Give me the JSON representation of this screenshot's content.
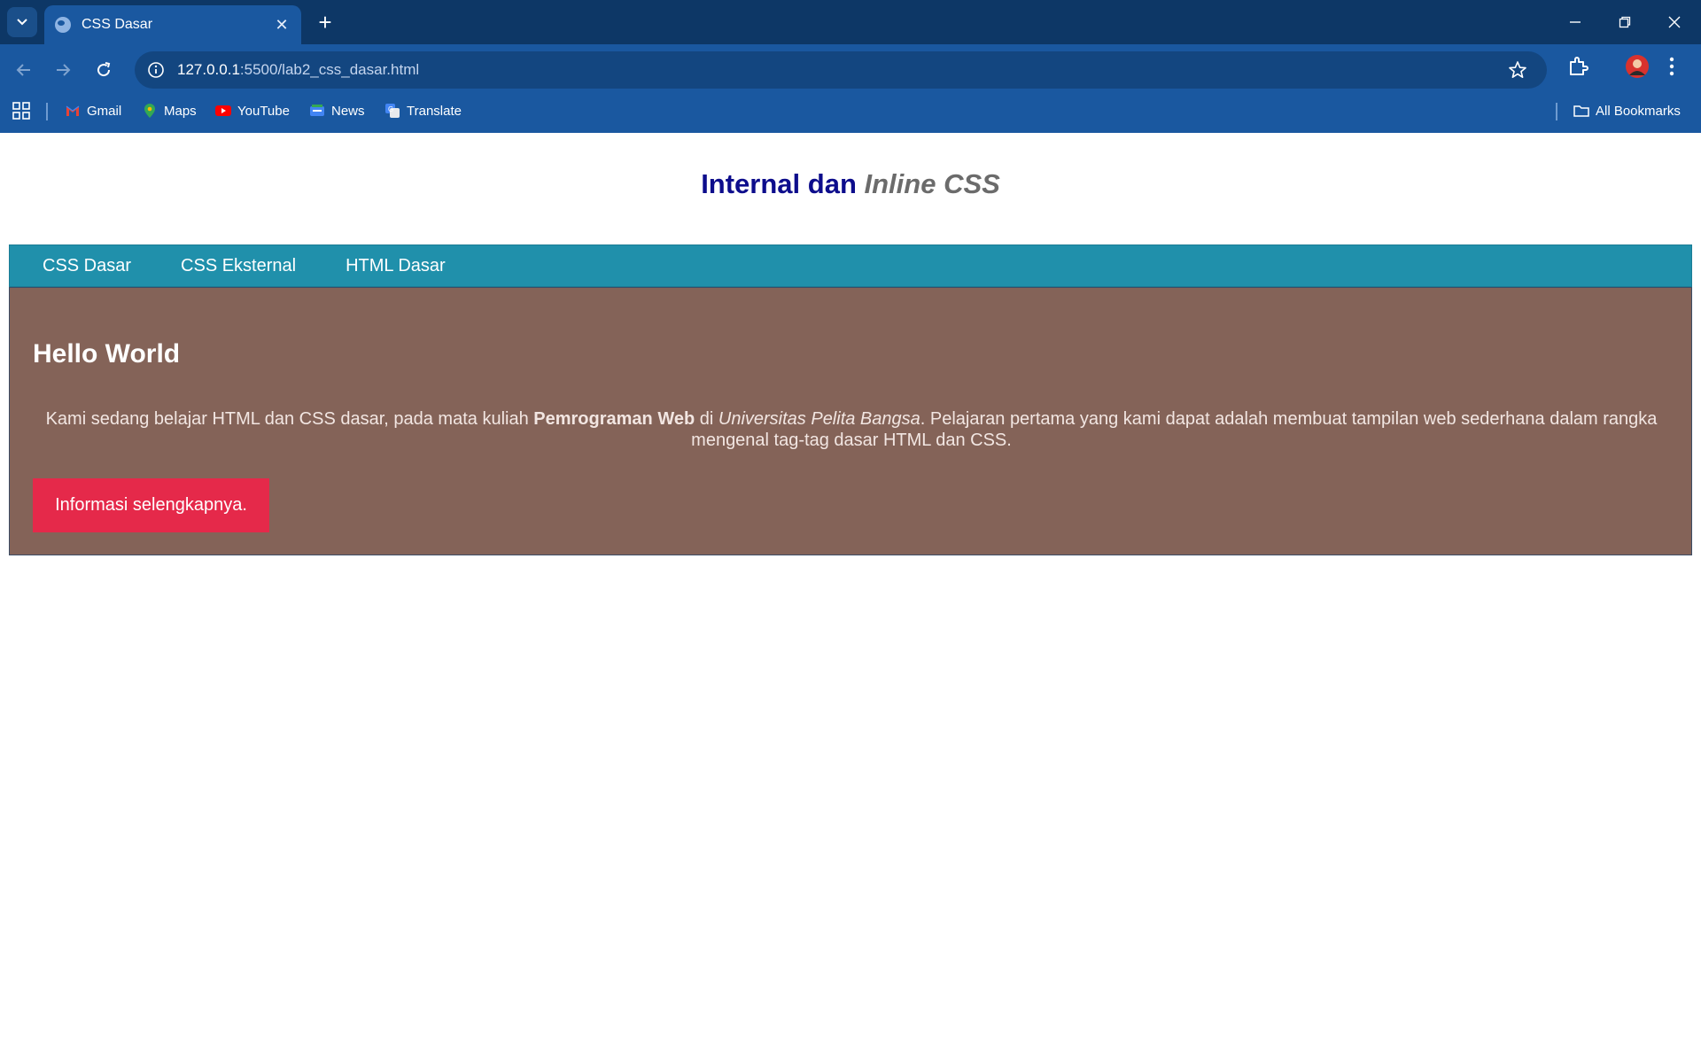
{
  "browser": {
    "tab_title": "CSS Dasar",
    "url_host": "127.0.0.1",
    "url_rest": ":5500/lab2_css_dasar.html",
    "bookmarks": [
      {
        "label": "Gmail",
        "icon": "gmail-icon"
      },
      {
        "label": "Maps",
        "icon": "maps-icon"
      },
      {
        "label": "YouTube",
        "icon": "youtube-icon"
      },
      {
        "label": "News",
        "icon": "news-icon"
      },
      {
        "label": "Translate",
        "icon": "translate-icon"
      }
    ],
    "all_bookmarks_label": "All Bookmarks"
  },
  "page": {
    "heading_plain": "Internal dan ",
    "heading_italic": "Inline",
    "heading_css": " CSS",
    "nav": [
      "CSS Dasar",
      "CSS Eksternal",
      "HTML Dasar"
    ],
    "hello": "Hello World",
    "para_start": "Kami sedang belajar HTML dan CSS dasar, pada mata kuliah ",
    "para_bold": "Pemrograman Web",
    "para_mid": " di ",
    "para_italic": "Universitas Pelita Bangsa",
    "para_end": ". Pelajaran pertama yang kami dapat adalah membuat tampilan web sederhana dalam rangka mengenal tag-tag dasar HTML dan CSS.",
    "button_label": "Informasi selengkapnya."
  },
  "colors": {
    "tabbar": "#0d3766",
    "toolbar": "#1a58a0",
    "nav_bg": "#2090ab",
    "content_bg": "#846358",
    "button_bg": "#e5294a",
    "heading": "#0d0d8c"
  }
}
